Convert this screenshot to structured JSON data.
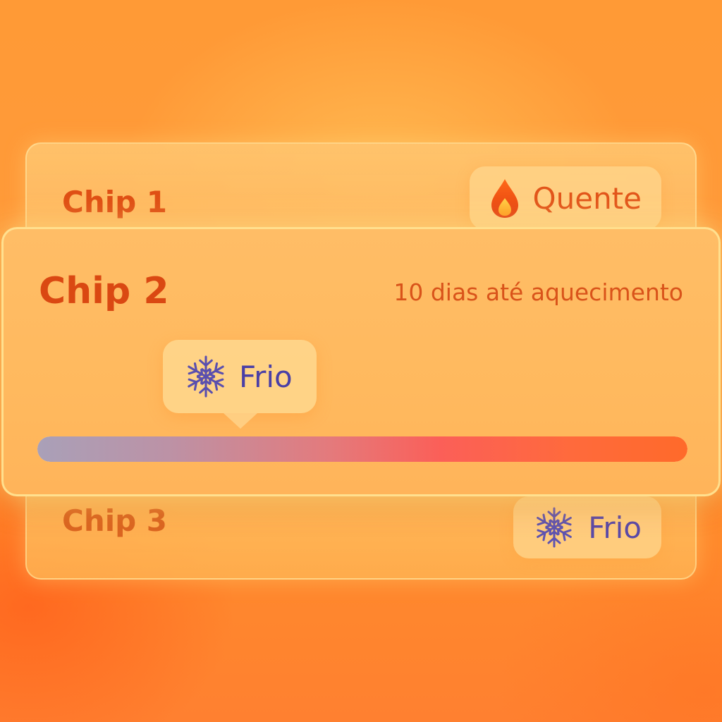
{
  "colors": {
    "accent": "#DE4F14",
    "hot": "#E2551A",
    "cold": "#4A3FA6",
    "background": "#FF9A36"
  },
  "chips": [
    {
      "title": "Chip 1",
      "status": {
        "icon": "flame-icon",
        "label": "Quente"
      }
    },
    {
      "title": "Chip 2",
      "countdown": "10 dias até aquecimento",
      "status": {
        "icon": "snowflake-icon",
        "label": "Frio"
      },
      "progress": 0.3
    },
    {
      "title": "Chip 3",
      "status": {
        "icon": "snowflake-icon",
        "label": "Frio"
      }
    }
  ]
}
